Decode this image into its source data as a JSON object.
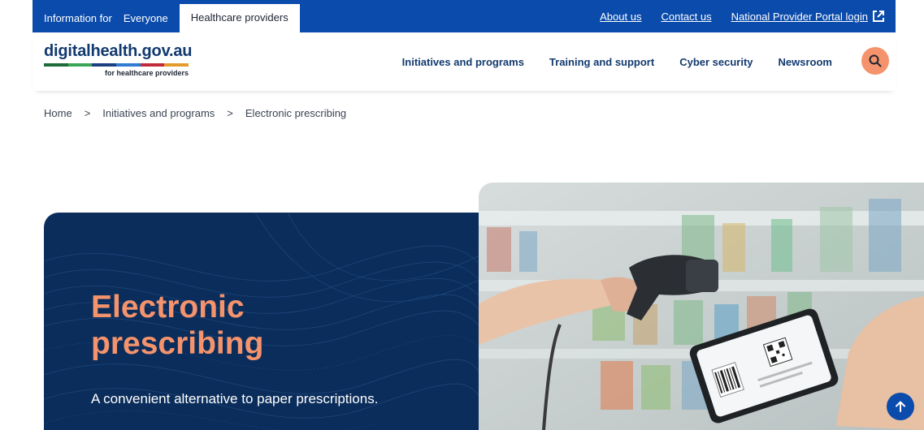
{
  "topbar": {
    "info_for_label": "Information for",
    "audience_tabs": [
      {
        "label": "Everyone",
        "active": false
      },
      {
        "label": "Healthcare providers",
        "active": true
      }
    ],
    "links": {
      "about": "About us",
      "contact": "Contact us",
      "portal": "National Provider Portal login"
    }
  },
  "header": {
    "logo_text": "digitalhealth.gov.au",
    "logo_subtitle": "for healthcare providers",
    "logo_stripe_colors": [
      "#1d6b3a",
      "#3aa655",
      "#1c3f82",
      "#2f7bd0",
      "#c02a3b",
      "#e39b2c"
    ],
    "nav": [
      "Initiatives and programs",
      "Training and support",
      "Cyber security",
      "Newsroom"
    ],
    "search_icon": "search-icon"
  },
  "breadcrumb": {
    "items": [
      "Home",
      "Initiatives and programs",
      "Electronic prescribing"
    ],
    "separator": ">"
  },
  "hero": {
    "title_line1": "Electronic",
    "title_line2": "prescribing",
    "subtitle": "A convenient alternative to paper prescriptions.",
    "image_description_icon": "barcode-scanner-phone-image"
  },
  "colors": {
    "topbar_bg": "#0b4bab",
    "nav_text": "#123a6f",
    "accent_orange": "#f4936c",
    "hero_bg": "#0b2d5b"
  },
  "back_to_top_icon": "arrow-up-icon"
}
